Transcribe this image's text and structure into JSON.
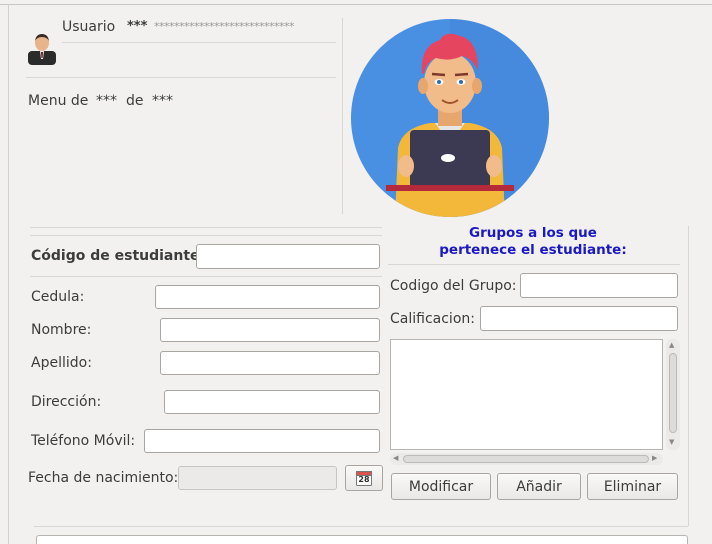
{
  "user": {
    "label": "Usuario",
    "value": "***",
    "masked": "****************************"
  },
  "menu": {
    "prefix": "Menu de",
    "role": "***",
    "middle": "de",
    "name": "***"
  },
  "student_form": {
    "code_label": "Código de estudiante:",
    "code_value": "",
    "cedula_label": "Cedula:",
    "cedula_value": "",
    "nombre_label": "Nombre:",
    "nombre_value": "",
    "apellido_label": "Apellido:",
    "apellido_value": "",
    "direccion_label": "Dirección:",
    "direccion_value": "",
    "telefono_label": "Teléfono Móvil:",
    "telefono_value": "",
    "fecha_label": "Fecha de nacimiento:",
    "fecha_value": "",
    "calendar_day": "28"
  },
  "groups": {
    "title_line1": "Grupos a los que",
    "title_line2": "pertenece el estudiante:",
    "codigo_label": "Codigo del Grupo:",
    "codigo_value": "",
    "calificacion_label": "Calificacion:",
    "calificacion_value": "",
    "list_items": [],
    "buttons": {
      "modificar": "Modificar",
      "anadir": "Añadir",
      "eliminar": "Eliminar"
    }
  },
  "colors": {
    "group_title": "#1a19c4",
    "avatar_bg": "#4a90e2"
  }
}
